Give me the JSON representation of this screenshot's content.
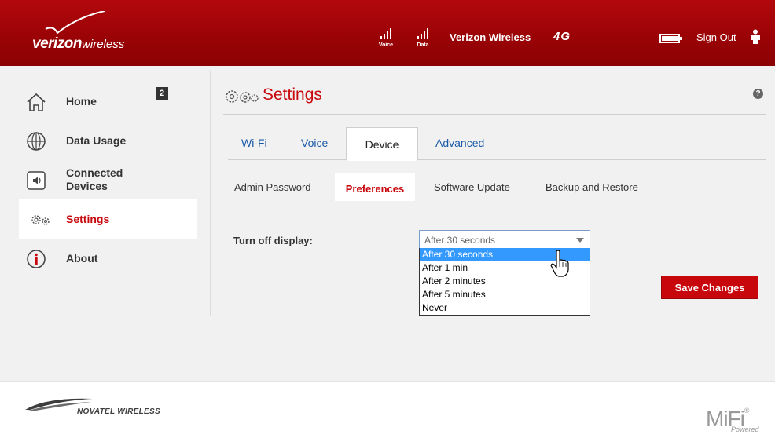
{
  "header": {
    "logo_primary": "verizon",
    "logo_secondary": "wireless",
    "signal_voice_label": "Voice",
    "signal_data_label": "Data",
    "carrier": "Verizon Wireless",
    "network": "4G",
    "sign_out": "Sign Out",
    "accent_color": "#a00305"
  },
  "nav": {
    "items": [
      {
        "label": "Home",
        "icon": "home-icon"
      },
      {
        "label": "Data Usage",
        "icon": "globe-icon"
      },
      {
        "label": "Connected Devices",
        "icon": "speaker-icon",
        "badge": "2"
      },
      {
        "label": "Settings",
        "icon": "gears-icon",
        "selected": true
      },
      {
        "label": "About",
        "icon": "info-icon"
      }
    ]
  },
  "main": {
    "title": "Settings",
    "help": "?",
    "tabs": [
      {
        "label": "Wi-Fi"
      },
      {
        "label": "Voice"
      },
      {
        "label": "Device",
        "active": true
      },
      {
        "label": "Advanced"
      }
    ],
    "subtabs": [
      {
        "label": "Admin Password"
      },
      {
        "label": "Preferences",
        "active": true
      },
      {
        "label": "Software Update"
      },
      {
        "label": "Backup and Restore"
      }
    ],
    "field_label": "Turn off display:",
    "select_value": "After 30 seconds",
    "options": [
      "After 30 seconds",
      "After 1 min",
      "After 2 minutes",
      "After 5 minutes",
      "Never"
    ],
    "highlighted_option_index": 0,
    "save_button": "Save Changes"
  },
  "footer": {
    "brand": "NOVATEL WIRELESS",
    "mifi": "MiFi",
    "mifi_mark": "®",
    "powered": "Powered"
  }
}
